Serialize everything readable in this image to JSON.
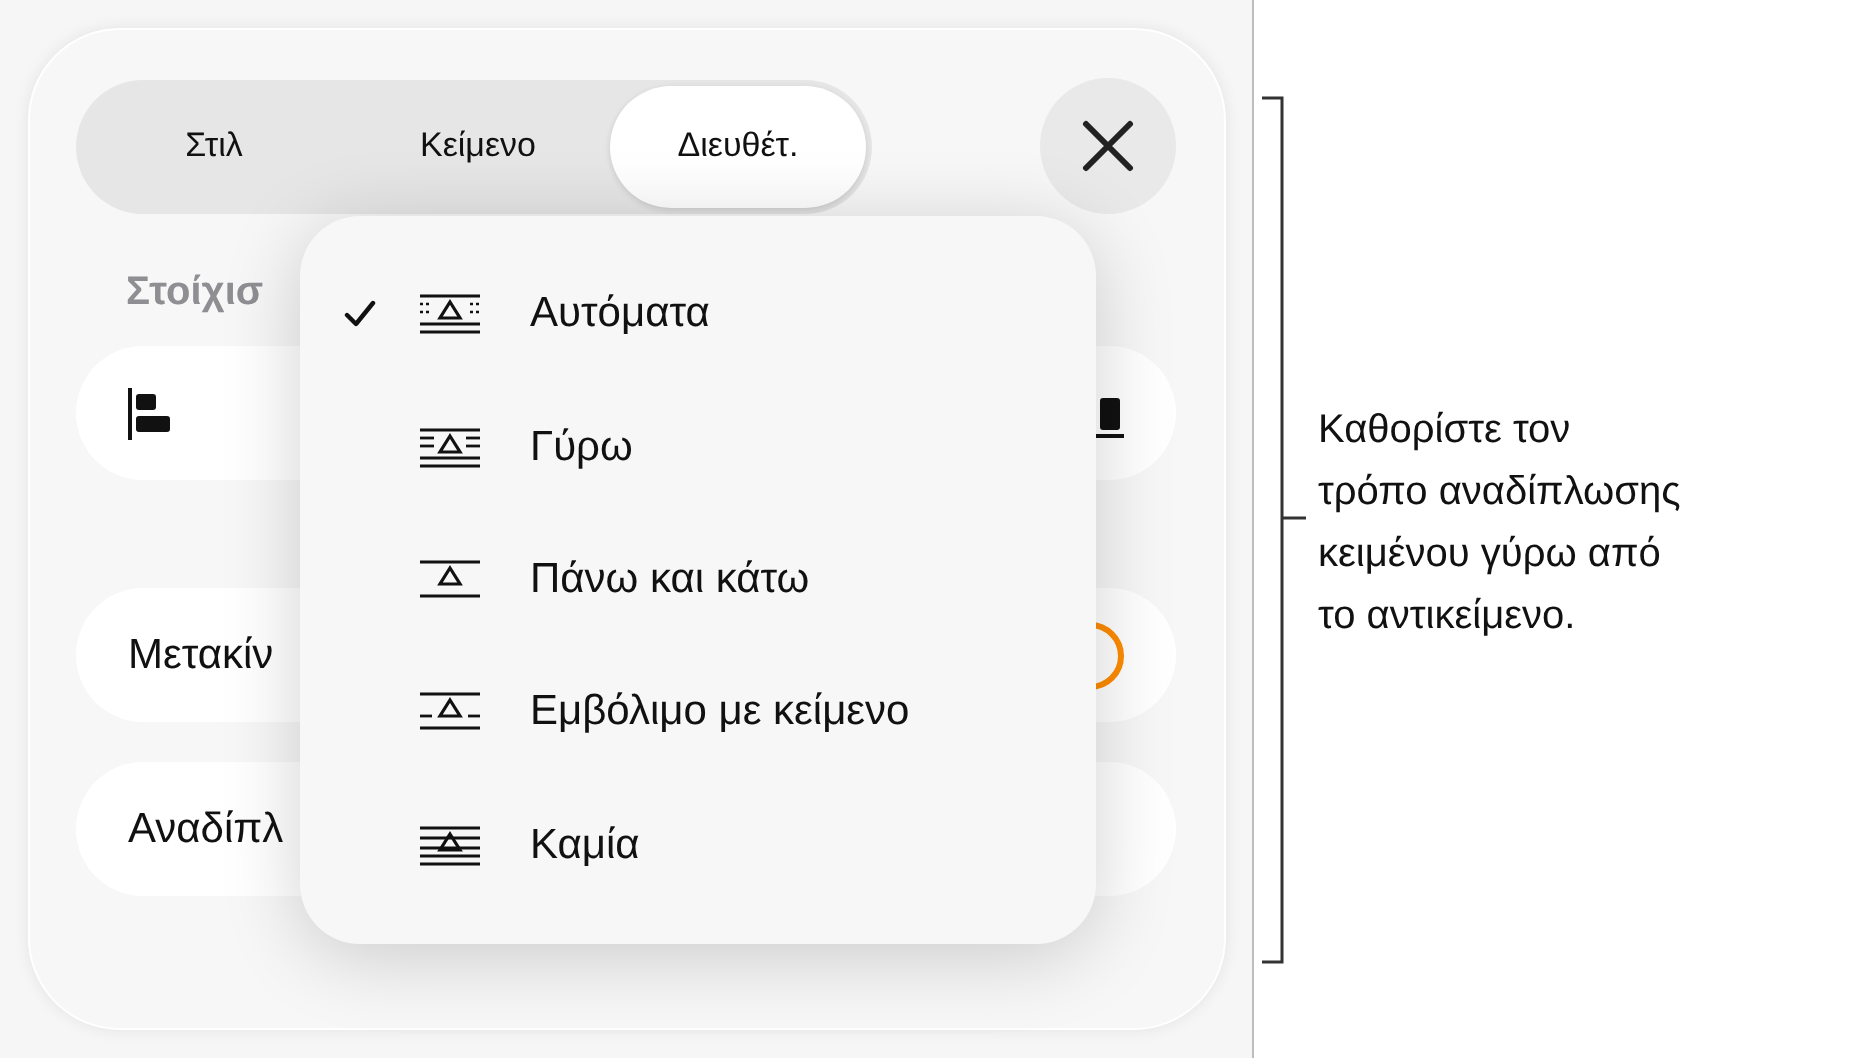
{
  "tabs": [
    {
      "label": "Στιλ",
      "selected": false
    },
    {
      "label": "Κείμενο",
      "selected": false
    },
    {
      "label": "Διευθέτ.",
      "selected": true
    }
  ],
  "section_heading": "Στοίχισ",
  "rows": [
    {
      "kind": "align"
    },
    {
      "kind": "toggle",
      "label": "Μετακίν",
      "on": true
    },
    {
      "kind": "plain",
      "label": "Αναδίπλ"
    }
  ],
  "menu": {
    "items": [
      {
        "label": "Αυτόματα",
        "selected": true,
        "kind": "auto"
      },
      {
        "label": "Γύρω",
        "selected": false,
        "kind": "around"
      },
      {
        "label": "Πάνω και κάτω",
        "selected": false,
        "kind": "above"
      },
      {
        "label": "Εμβόλιμο με κείμενο",
        "selected": false,
        "kind": "inline"
      },
      {
        "label": "Καμία",
        "selected": false,
        "kind": "none"
      }
    ]
  },
  "callout": "Καθορίστε τον\nτρόπο αναδίπλωσης\nκειμένου γύρω από\nτο αντικείμενο."
}
